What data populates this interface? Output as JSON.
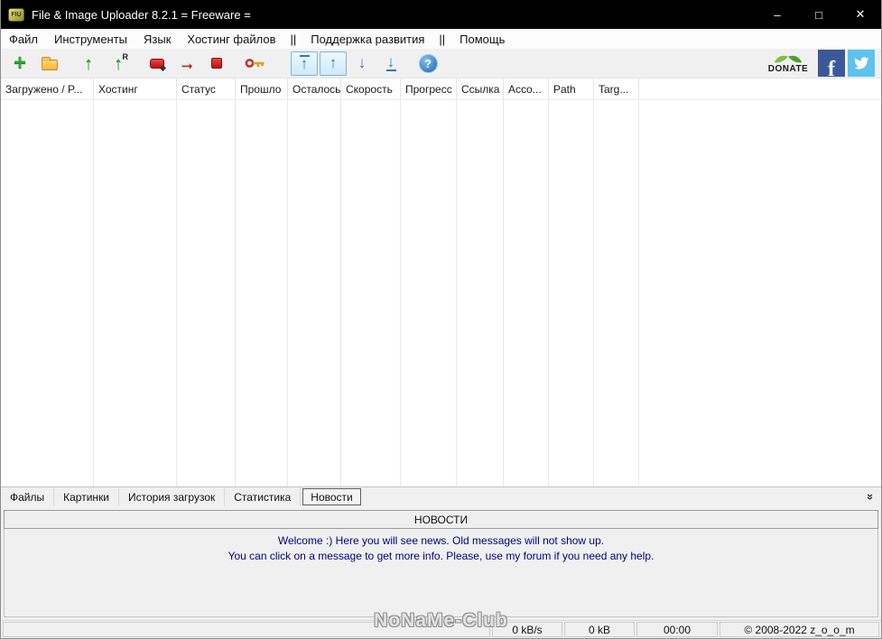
{
  "window": {
    "title": "File & Image Uploader 8.2.1  = Freeware =",
    "minimize": "–",
    "maximize": "□",
    "close": "✕"
  },
  "menu": {
    "items": [
      "Файл",
      "Инструменты",
      "Язык",
      "Хостинг файлов",
      "||",
      "Поддержка развития",
      "||",
      "Помощь"
    ]
  },
  "toolbar": {
    "add_glyph": "+",
    "upload_glyph": "↑",
    "resume_badge": "R",
    "skip_glyph": "→",
    "nav_glyphs": [
      "↑",
      "↑",
      "↓",
      "↓"
    ],
    "help_glyph": "?",
    "donate_label": "DONATE",
    "facebook_glyph": "f"
  },
  "columns": [
    "Загружено / P...",
    "Хостинг",
    "Статус",
    "Прошло",
    "Осталось",
    "Скорость",
    "Прогресс",
    "Ссылка",
    "Acco...",
    "Path",
    "Targ..."
  ],
  "tabs": {
    "items": [
      "Файлы",
      "Картинки",
      "История загрузок",
      "Статистика",
      "Новости"
    ],
    "selected": "Новости",
    "chevron": "»"
  },
  "news": {
    "header": "НОВОСТИ",
    "line1": "Welcome :) Here you will see news. Old messages will not show up.",
    "line2": "You can click on a message to get more info. Please, use my forum if you need any help."
  },
  "watermark": "NoNaMe-Club",
  "status": {
    "speed": "0 kB/s",
    "size": "0 kB",
    "time": "00:00",
    "copyright": "© 2008-2022 z_o_o_m"
  }
}
